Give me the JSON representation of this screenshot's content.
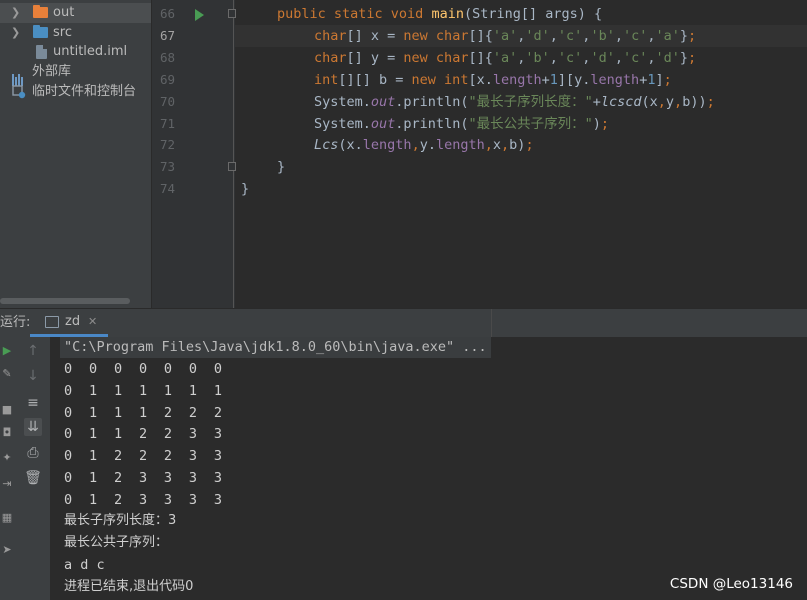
{
  "project_tree": {
    "items": [
      {
        "label": "out",
        "icon": "folder-icon",
        "expanded": false
      },
      {
        "label": "src",
        "icon": "folder-icon",
        "expanded": false
      },
      {
        "label": "untitled.iml",
        "icon": "iml-file-icon"
      },
      {
        "label": "外部库",
        "icon": "library-icon"
      },
      {
        "label": "临时文件和控制台",
        "icon": "scratch-icon"
      }
    ]
  },
  "editor": {
    "line_numbers": [
      "66",
      "67",
      "68",
      "69",
      "70",
      "71",
      "72",
      "73",
      "74"
    ],
    "current_line": "67",
    "lines": [
      "public static void main(String[] args) {",
      "char[] x = new char[]{'a','d','c','b','c','a'};",
      "char[] y = new char[]{'a','b','c','d','c','d'};",
      "int[][] b = new int[x.length+1][y.length+1];",
      "System.out.println(\"最长子序列长度：\"+lcscd(x,y,b));",
      "System.out.println(\"最长公共子序列：\");",
      "Lcs(x.length,y.length,x,b);",
      "}",
      "}"
    ]
  },
  "run_panel": {
    "title": "运行:",
    "tab_label": "zd",
    "command": "\"C:\\Program Files\\Java\\jdk1.8.0_60\\bin\\java.exe\" ...",
    "matrix": [
      "0  0  0  0  0  0  0",
      "0  1  1  1  1  1  1",
      "0  1  1  1  2  2  2",
      "0  1  1  2  2  3  3",
      "0  1  2  2  2  3  3",
      "0  1  2  3  3  3  3",
      "0  1  2  3  3  3  3"
    ],
    "output_lines": [
      "最长子序列长度：3",
      "最长公共子序列：",
      "a d c",
      "进程已结束,退出代码0"
    ]
  },
  "watermark": "CSDN @Leo13146",
  "colors": {
    "keyword": "#cc7832",
    "string": "#6a8759",
    "number": "#6897bb",
    "field": "#9876aa",
    "folder_out": "#e8803a",
    "folder_src": "#4a8ec2"
  }
}
